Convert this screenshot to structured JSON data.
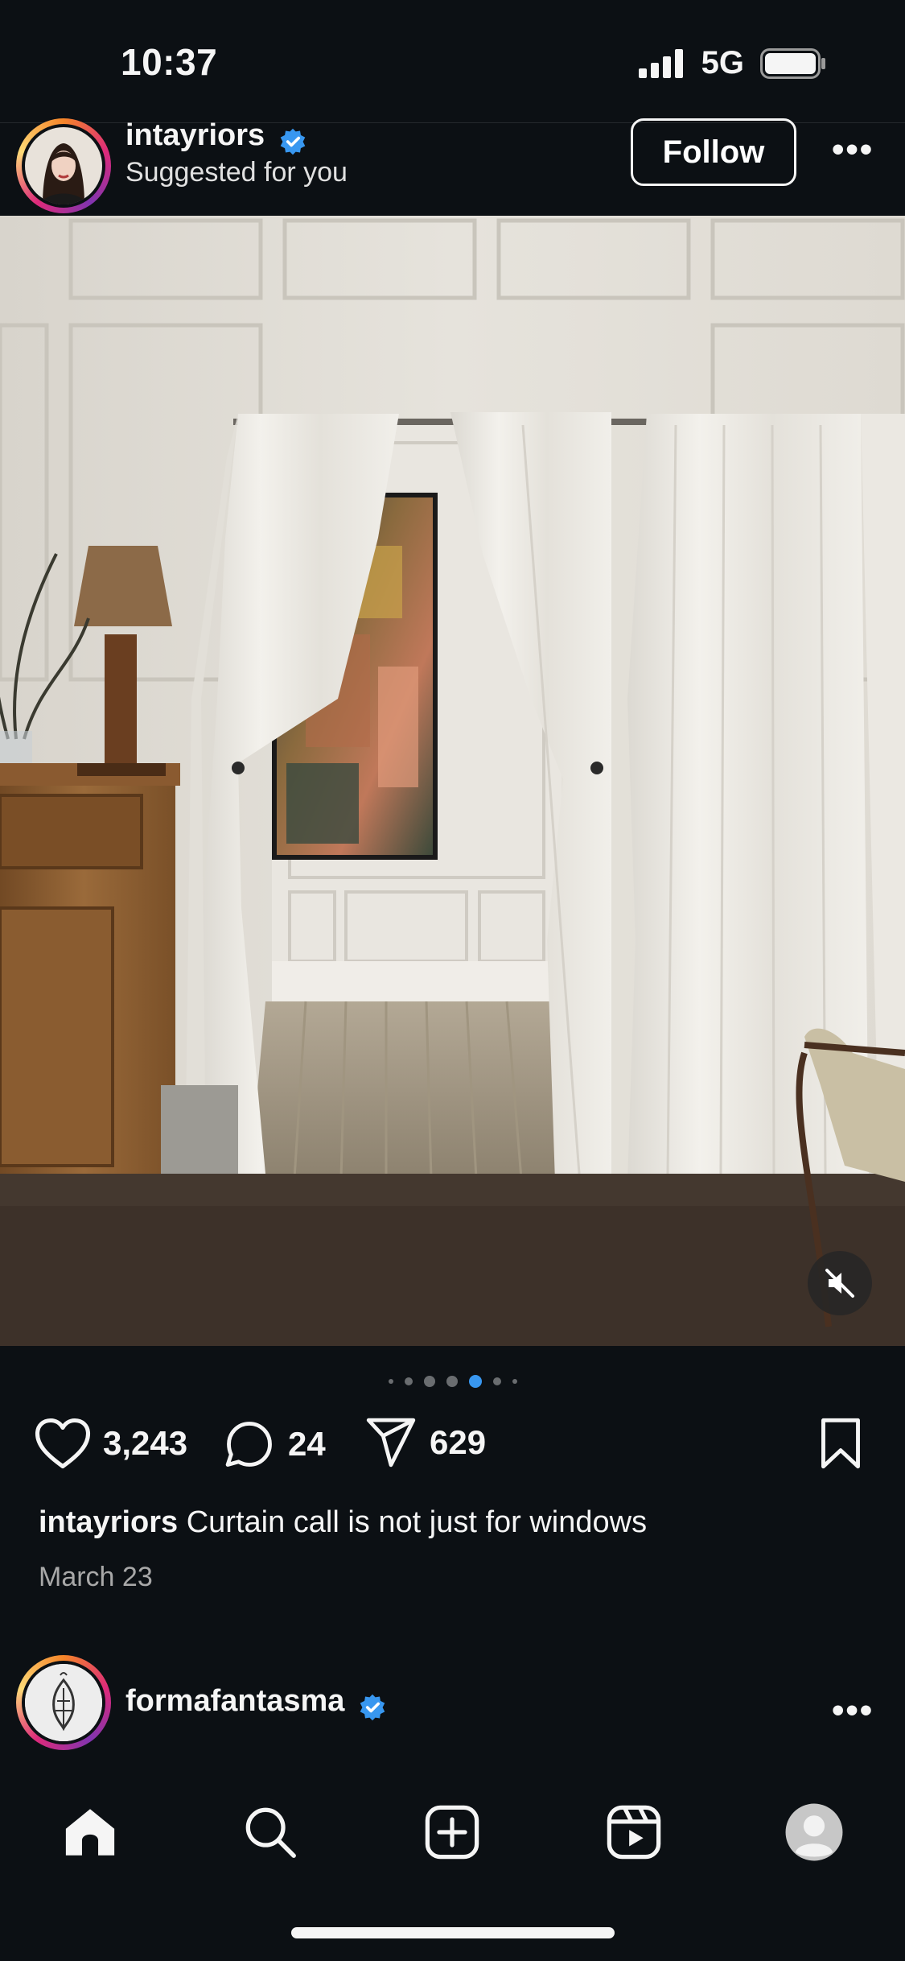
{
  "status": {
    "time": "10:37",
    "network": "5G"
  },
  "post": {
    "username": "intayriors",
    "subtitle": "Suggested for you",
    "follow_label": "Follow",
    "more_label": "•••",
    "likes": "3,243",
    "comments": "24",
    "shares": "629",
    "caption_user": "intayriors",
    "caption_text": "Curtain call is not just for windows",
    "date": "March 23",
    "carousel": {
      "total": 7,
      "active_index": 4
    }
  },
  "next_post": {
    "username": "formafantasma",
    "more_label": "•••"
  },
  "tabbar": {
    "items": [
      "home",
      "search",
      "create",
      "reels",
      "profile"
    ],
    "active": "home"
  },
  "colors": {
    "background": "#0c1014",
    "verified": "#3897f0",
    "active_dot": "#3897f0"
  }
}
